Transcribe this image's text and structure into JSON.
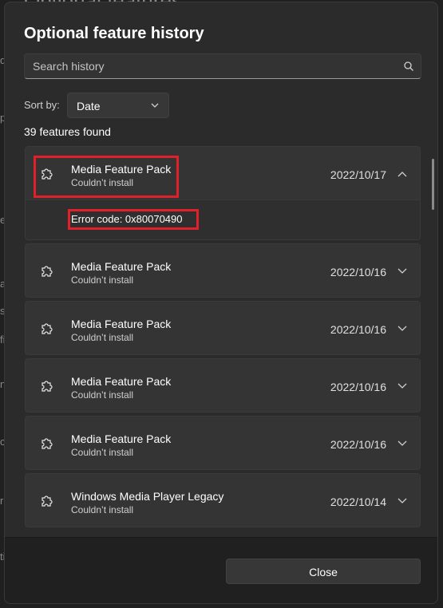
{
  "background": {
    "title": "Optional features",
    "edge_letters": [
      "d",
      "p",
      "e",
      "a",
      "st",
      "fi",
      "n",
      "ct",
      "ro",
      "ti"
    ]
  },
  "dialog": {
    "title": "Optional feature history",
    "search": {
      "placeholder": "Search history",
      "value": ""
    },
    "sort": {
      "label": "Sort by:",
      "value": "Date"
    },
    "count_text": "39 features found",
    "items": [
      {
        "name": "Media Feature Pack",
        "status": "Couldn’t install",
        "date": "2022/10/17",
        "expanded": true,
        "detail": "Error code: 0x80070490"
      },
      {
        "name": "Media Feature Pack",
        "status": "Couldn’t install",
        "date": "2022/10/16",
        "expanded": false
      },
      {
        "name": "Media Feature Pack",
        "status": "Couldn’t install",
        "date": "2022/10/16",
        "expanded": false
      },
      {
        "name": "Media Feature Pack",
        "status": "Couldn’t install",
        "date": "2022/10/16",
        "expanded": false
      },
      {
        "name": "Media Feature Pack",
        "status": "Couldn’t install",
        "date": "2022/10/16",
        "expanded": false
      },
      {
        "name": "Windows Media Player Legacy",
        "status": "Couldn’t install",
        "date": "2022/10/14",
        "expanded": false
      }
    ],
    "close_label": "Close"
  },
  "colors": {
    "highlight": "#e0212b",
    "dialog_bg": "#2b2b2b",
    "card_bg": "#343434"
  },
  "icons": {
    "feature": "puzzle-icon",
    "search": "search-icon",
    "expand": "chevron-down-icon",
    "collapse": "chevron-up-icon"
  }
}
